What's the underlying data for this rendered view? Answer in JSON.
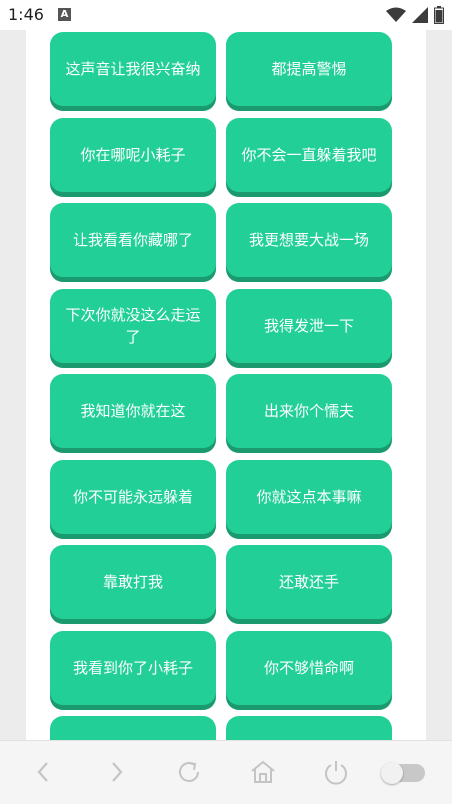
{
  "status_bar": {
    "time": "1:46",
    "notification_badge": "A",
    "icons": [
      "wifi-icon",
      "signal-icon",
      "battery-icon"
    ]
  },
  "buttons": [
    "这声音让我很兴奋纳",
    "都提高警惕",
    "你在哪呢小耗子",
    "你不会一直躲着我吧",
    "让我看看你藏哪了",
    "我更想要大战一场",
    "下次你就没这么走运了",
    "我得发泄一下",
    "我知道你就在这",
    "出来你个懦夫",
    "你不可能永远躲着",
    "你就这点本事嘛",
    "靠敢打我",
    "还敢还手",
    "我看到你了小耗子",
    "你不够惜命啊",
    "",
    ""
  ],
  "nav": {
    "icons": [
      "back-icon",
      "forward-icon",
      "refresh-icon",
      "home-icon",
      "power-icon"
    ],
    "toggle_on": false
  },
  "colors": {
    "button": "#22d097",
    "button_shadow": "#1b9a6f",
    "button_text": "#ffffff",
    "background": "#ebeceb"
  }
}
